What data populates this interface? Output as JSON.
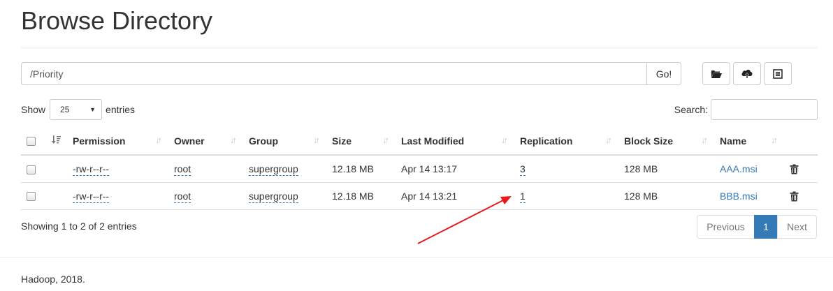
{
  "page": {
    "title": "Browse Directory"
  },
  "path_bar": {
    "value": "/Priority",
    "go_label": "Go!"
  },
  "toolbar": {
    "icons": [
      "folder-open-icon",
      "cloud-upload-icon",
      "list-icon"
    ]
  },
  "length": {
    "show_label": "Show",
    "selected": "25",
    "entries_label": "entries"
  },
  "search": {
    "label": "Search:",
    "value": ""
  },
  "table": {
    "columns": [
      "Permission",
      "Owner",
      "Group",
      "Size",
      "Last Modified",
      "Replication",
      "Block Size",
      "Name"
    ],
    "rows": [
      {
        "permission": "-rw-r--r--",
        "owner": "root",
        "group": "supergroup",
        "size": "12.18 MB",
        "modified": "Apr 14 13:17",
        "replication": "3",
        "block_size": "128 MB",
        "name": "AAA.msi"
      },
      {
        "permission": "-rw-r--r--",
        "owner": "root",
        "group": "supergroup",
        "size": "12.18 MB",
        "modified": "Apr 14 13:21",
        "replication": "1",
        "block_size": "128 MB",
        "name": "BBB.msi"
      }
    ]
  },
  "info": "Showing 1 to 2 of 2 entries",
  "pagination": {
    "previous": "Previous",
    "current": "1",
    "next": "Next"
  },
  "footer": "Hadoop, 2018.",
  "colors": {
    "link": "#337ab7",
    "annotation_arrow": "#e8191c"
  }
}
